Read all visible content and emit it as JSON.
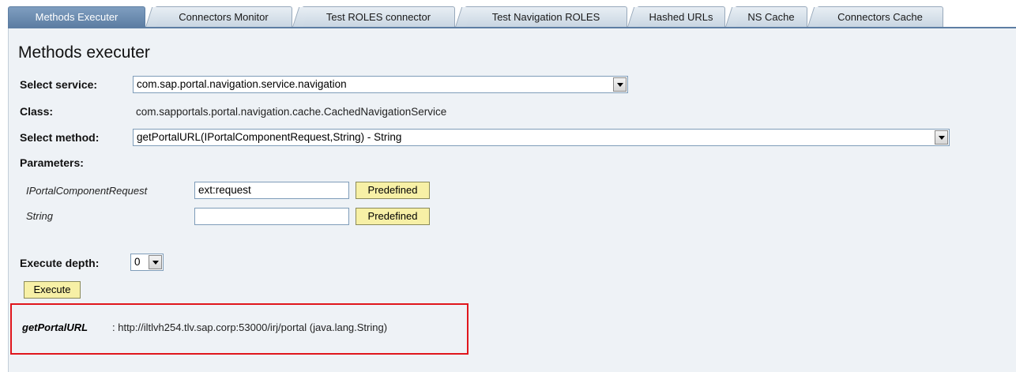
{
  "tabs": [
    {
      "label": "Methods Executer",
      "selected": true
    },
    {
      "label": "Connectors Monitor",
      "selected": false
    },
    {
      "label": "Test ROLES connector",
      "selected": false
    },
    {
      "label": "Test Navigation ROLES",
      "selected": false
    },
    {
      "label": "Hashed URLs",
      "selected": false
    },
    {
      "label": "NS Cache",
      "selected": false
    },
    {
      "label": "Connectors Cache",
      "selected": false
    }
  ],
  "page": {
    "title": "Methods executer"
  },
  "form": {
    "service_label": "Select service:",
    "service_value": "com.sap.portal.navigation.service.navigation",
    "class_label": "Class:",
    "class_value": "com.sapportals.portal.navigation.cache.CachedNavigationService",
    "method_label": "Select method:",
    "method_value": "getPortalURL(IPortalComponentRequest,String) - String",
    "parameters_label": "Parameters:",
    "parameters": [
      {
        "name": "IPortalComponentRequest",
        "value": "ext:request",
        "button": "Predefined"
      },
      {
        "name": "String",
        "value": "",
        "button": "Predefined"
      }
    ],
    "depth_label": "Execute depth:",
    "depth_value": "0",
    "execute_label": "Execute"
  },
  "result": {
    "method": "getPortalURL",
    "text": ": http://iltlvh254.tlv.sap.corp:53000/irj/portal (java.lang.String)"
  },
  "colors": {
    "highlight_border": "#e0161c",
    "button_bg": "#f7f0a6",
    "selected_tab": "#5d7ea3"
  }
}
